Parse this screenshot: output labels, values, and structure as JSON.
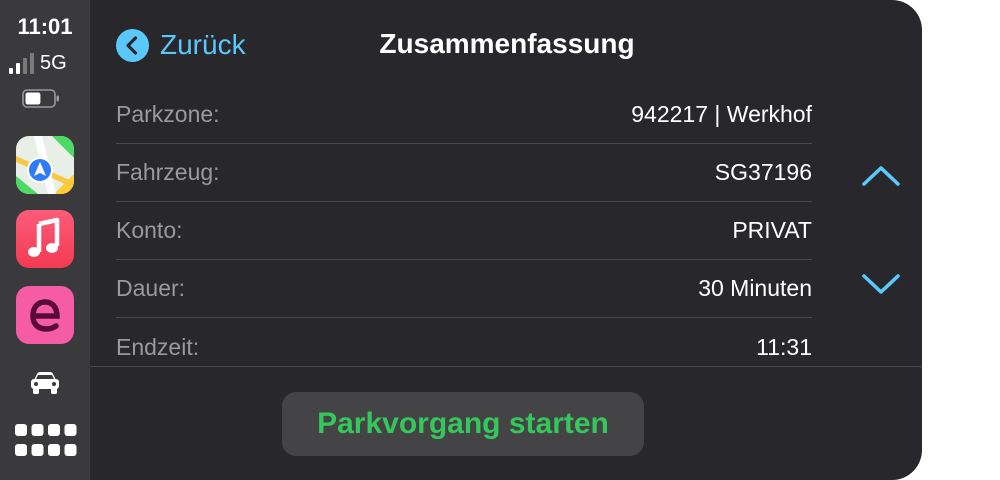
{
  "status_bar": {
    "time": "11:01",
    "network": "5G",
    "signal_bars_filled": 2,
    "signal_bars_total": 4,
    "battery_level": 0.55
  },
  "dock": {
    "apps": [
      {
        "name": "Maps",
        "icon": "maps-icon"
      },
      {
        "name": "Music",
        "icon": "music-note-icon"
      },
      {
        "name": "EasyPark",
        "icon": "e-logo-icon"
      }
    ],
    "car_icon": "car-icon",
    "grid_icon": "app-grid-icon"
  },
  "header": {
    "back_label": "Zurück",
    "title": "Zusammenfassung"
  },
  "summary": {
    "rows": [
      {
        "label": "Parkzone:",
        "value": "942217 | Werkhof"
      },
      {
        "label": "Fahrzeug:",
        "value": "SG37196"
      },
      {
        "label": "Konto:",
        "value": "PRIVAT"
      },
      {
        "label": "Dauer:",
        "value": "30 Minuten"
      },
      {
        "label": "Endzeit:",
        "value": "11:31"
      }
    ]
  },
  "actions": {
    "start_label": "Parkvorgang starten"
  },
  "colors": {
    "accent_blue": "#5ac8fa",
    "start_green": "#34c759",
    "background": "#28282c",
    "sidebar": "#3a3a3d"
  }
}
